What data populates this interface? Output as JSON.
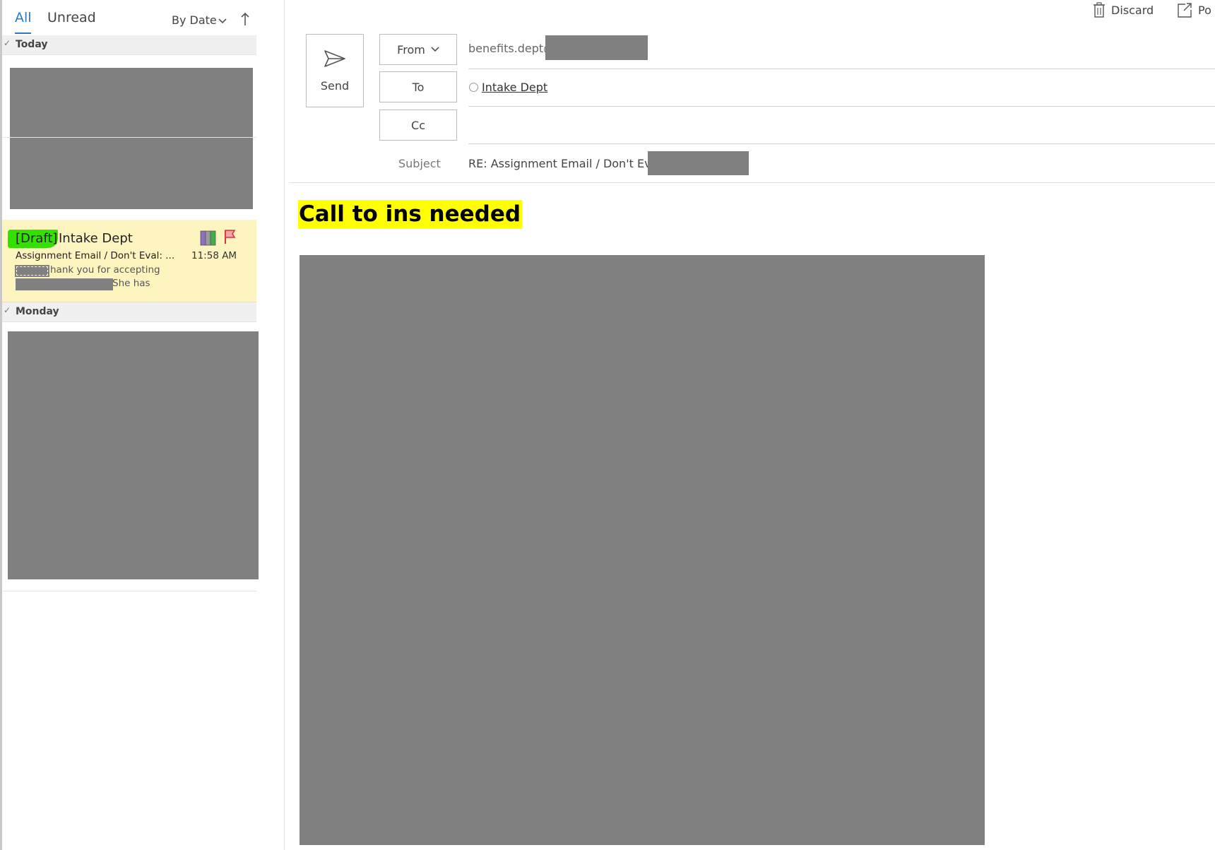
{
  "filters": {
    "all": "All",
    "unread": "Unread"
  },
  "sort": {
    "label": "By Date"
  },
  "groups": {
    "today": "Today",
    "monday": "Monday"
  },
  "draft_item": {
    "tag": "[Draft]",
    "sender": "Intake Dept",
    "subject": "Assignment Email / Don't Eval: ...",
    "time": "11:58 AM",
    "preview_line1": "hank you for accepting",
    "preview_line2": "She has"
  },
  "toolbar": {
    "discard": "Discard",
    "popout": "Po"
  },
  "compose": {
    "send": "Send",
    "from_label": "From",
    "from_value": "benefits.dept@",
    "to_label": "To",
    "to_recipient": "Intake Dept",
    "cc_label": "Cc",
    "subject_label": "Subject",
    "subject_value": "RE: Assignment Email / Don't Eval: "
  },
  "body": {
    "heading": "Call to ins needed"
  },
  "colors": {
    "accent": "#2b79c7",
    "draft_bg": "#fef4c0",
    "draft_highlight": "#33e100",
    "body_highlight": "#ffff00",
    "redaction": "#808080"
  },
  "icons": [
    "chevron-down-icon",
    "sort-ascending-icon",
    "category-color-icon",
    "flag-icon",
    "send-icon",
    "trash-icon",
    "popout-icon"
  ]
}
